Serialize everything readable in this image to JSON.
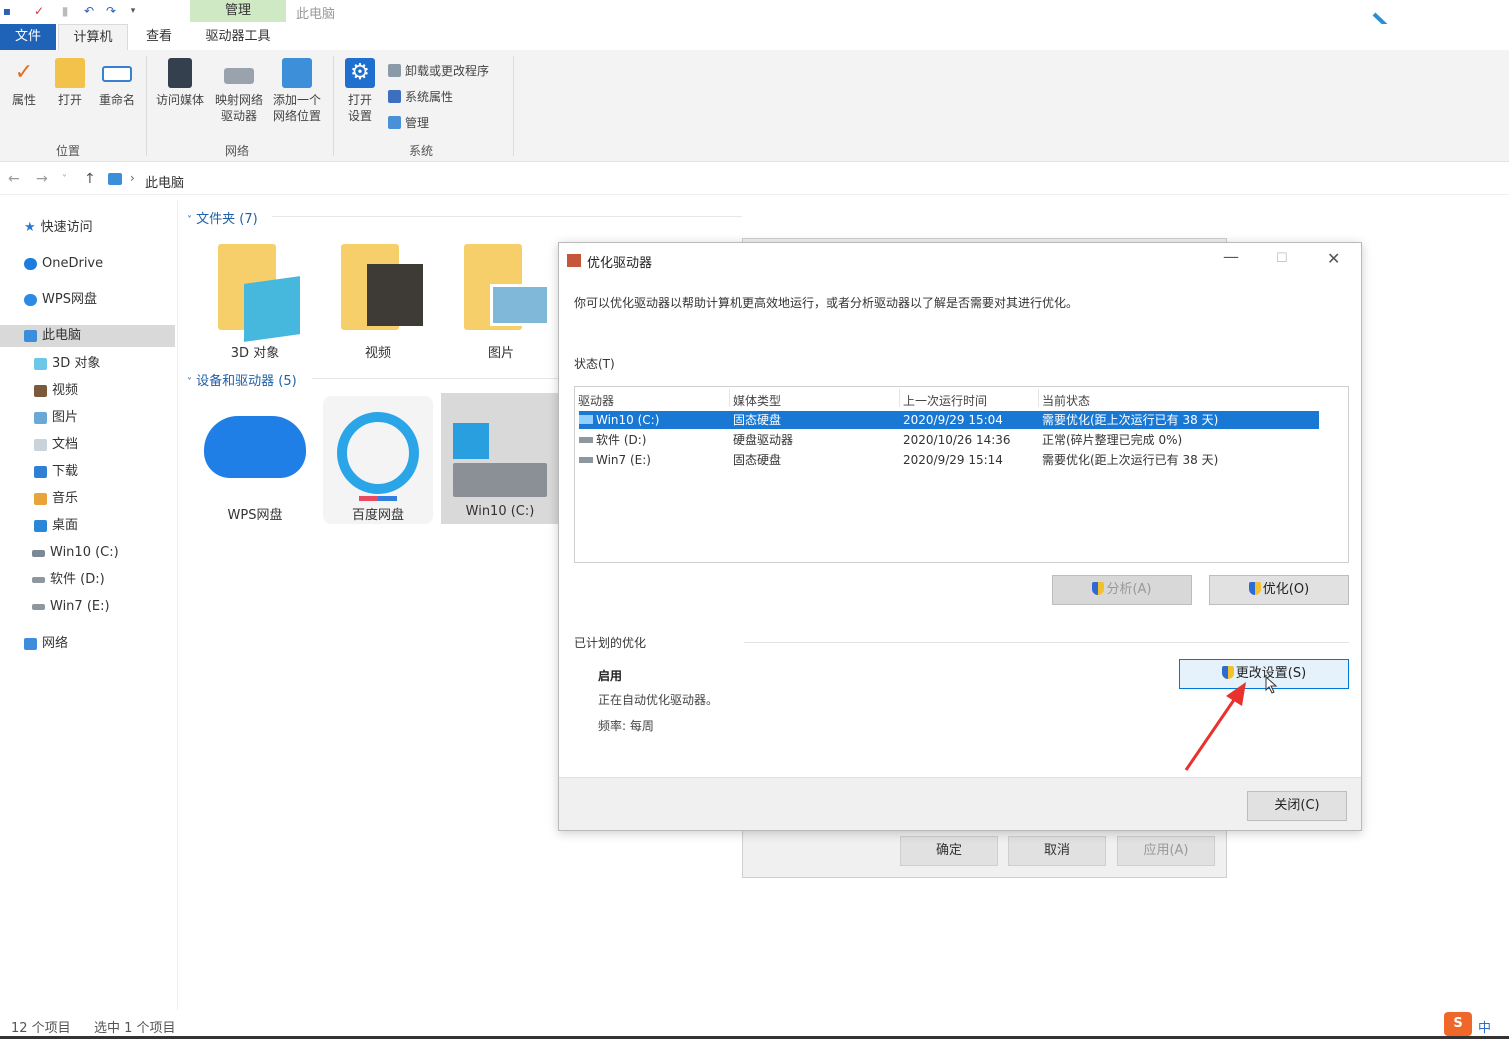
{
  "window": {
    "context_tab": "管理",
    "title": "此电脑"
  },
  "tabs": {
    "file": "文件",
    "computer": "计算机",
    "view": "查看",
    "drive_tools": "驱动器工具"
  },
  "ribbon": {
    "location": {
      "group": "位置",
      "properties": "属性",
      "open": "打开",
      "rename": "重命名"
    },
    "network": {
      "group": "网络",
      "media": "访问媒体",
      "map_drive_1": "映射网络",
      "map_drive_2": "驱动器",
      "add_loc_1": "添加一个",
      "add_loc_2": "网络位置"
    },
    "system": {
      "group": "系统",
      "open_settings_1": "打开",
      "open_settings_2": "设置",
      "uninstall": "卸载或更改程序",
      "sys_props": "系统属性",
      "manage": "管理"
    }
  },
  "address": {
    "path": "此电脑"
  },
  "nav": {
    "quick_access": "快速访问",
    "onedrive": "OneDrive",
    "wps": "WPS网盘",
    "this_pc": "此电脑",
    "objects3d": "3D 对象",
    "videos": "视频",
    "pictures": "图片",
    "documents": "文档",
    "downloads": "下载",
    "music": "音乐",
    "desktop": "桌面",
    "drive_c": "Win10 (C:)",
    "drive_d": "软件 (D:)",
    "drive_e": "Win7 (E:)",
    "network": "网络"
  },
  "content": {
    "folders_header": "文件夹 (7)",
    "devices_header": "设备和驱动器 (5)",
    "folders": [
      "3D 对象",
      "视频",
      "图片"
    ],
    "devices": [
      "WPS网盘",
      "百度网盘",
      "Win10 (C:)"
    ]
  },
  "bg_dialog": {
    "ok": "确定",
    "cancel": "取消",
    "apply": "应用(A)"
  },
  "optimize": {
    "title": "优化驱动器",
    "intro": "你可以优化驱动器以帮助计算机更高效地运行，或者分析驱动器以了解是否需要对其进行优化。",
    "status_label": "状态(T)",
    "columns": [
      "驱动器",
      "媒体类型",
      "上一次运行时间",
      "当前状态"
    ],
    "rows": [
      {
        "drive": "Win10 (C:)",
        "media": "固态硬盘",
        "last": "2020/9/29 15:04",
        "state": "需要优化(距上次运行已有 38 天)"
      },
      {
        "drive": "软件 (D:)",
        "media": "硬盘驱动器",
        "last": "2020/10/26 14:36",
        "state": "正常(碎片整理已完成 0%)"
      },
      {
        "drive": "Win7 (E:)",
        "media": "固态硬盘",
        "last": "2020/9/29 15:14",
        "state": "需要优化(距上次运行已有 38 天)"
      }
    ],
    "analyze": "分析(A)",
    "optimize": "优化(O)",
    "scheduled_label": "已计划的优化",
    "enabled": "启用",
    "auto_text": "正在自动优化驱动器。",
    "frequency": "频率: 每周",
    "change_settings": "更改设置(S)",
    "close": "关闭(C)"
  },
  "statusbar": {
    "items": "12 个项目",
    "selected": "选中 1 个项目"
  },
  "tray": {
    "ime": "中"
  },
  "colors": {
    "accent": "#1978d4",
    "file_tab": "#1f63b8",
    "context_tab": "#cfe9c4",
    "arrow": "#e8322b"
  }
}
